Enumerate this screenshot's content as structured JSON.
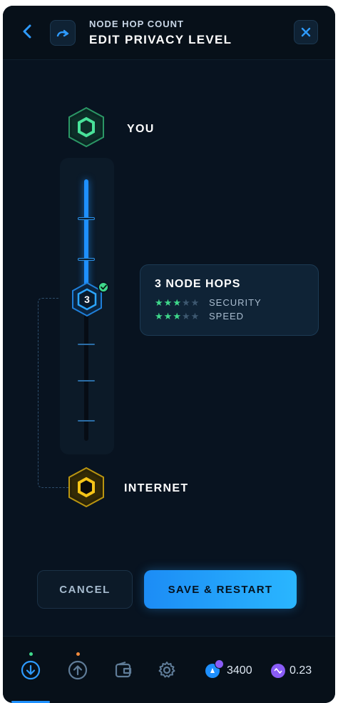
{
  "header": {
    "subtitle": "NODE HOP COUNT",
    "title": "EDIT PRIVACY LEVEL"
  },
  "route": {
    "start_label": "YOU",
    "end_label": "INTERNET"
  },
  "slider": {
    "value": "3",
    "min": 1,
    "max": 8,
    "selected": 3
  },
  "info": {
    "title": "3 NODE HOPS",
    "security": {
      "label": "SECURITY",
      "rating": 3,
      "max": 5
    },
    "speed": {
      "label": "SPEED",
      "rating": 3,
      "max": 5
    }
  },
  "buttons": {
    "cancel": "CANCEL",
    "save": "SAVE & RESTART"
  },
  "balances": {
    "token_amount": "3400",
    "crypto_amount": "0.23"
  },
  "colors": {
    "accent": "#1e90ff",
    "success": "#3fd98b",
    "start_node": "#3fd98b",
    "end_node": "#f5c518",
    "background": "#081320"
  }
}
